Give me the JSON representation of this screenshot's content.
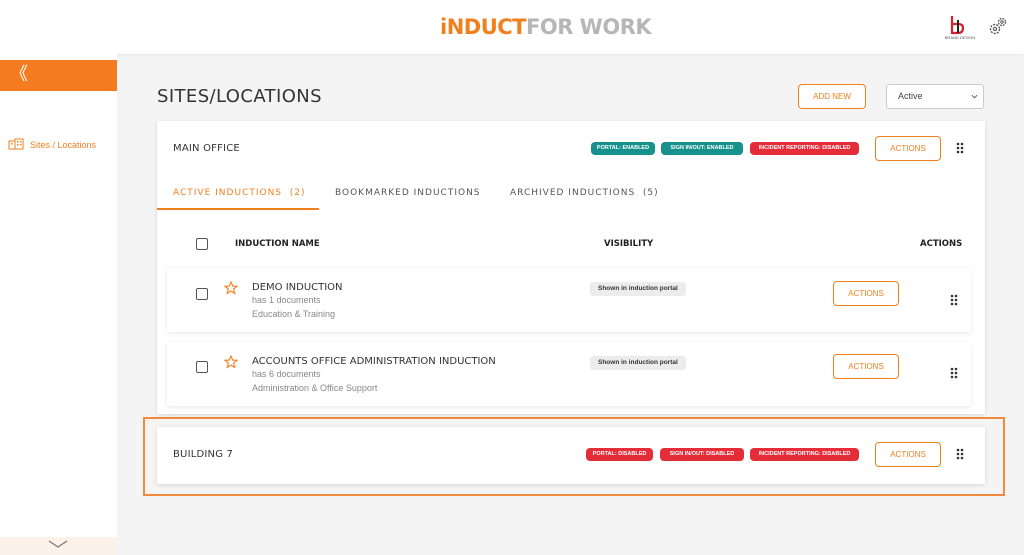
{
  "header": {
    "logo_part1": "iNDUCT",
    "logo_part2": "FOR WORK",
    "brand_text": "BRAND DESIGN"
  },
  "sidebar": {
    "collapse_glyph": "《",
    "items": [
      {
        "label": "Sites / Locations",
        "icon": "buildings-icon"
      }
    ]
  },
  "page": {
    "title": "SITES/LOCATIONS",
    "add_new_label": "ADD NEW",
    "status_filter": {
      "selected": "Active"
    }
  },
  "sites": [
    {
      "name": "MAIN OFFICE",
      "badges": [
        {
          "label": "PORTAL: ENABLED",
          "color": "#17918c"
        },
        {
          "label": "SIGN IN/OUT: ENABLED",
          "color": "#17918c"
        },
        {
          "label": "INCIDENT REPORTING: DISABLED",
          "color": "#e42d38"
        }
      ],
      "actions_label": "ACTIONS",
      "tabs": [
        {
          "label": "ACTIVE INDUCTIONS",
          "count": "(2)",
          "active": true
        },
        {
          "label": "BOOKMARKED INDUCTIONS",
          "count": "",
          "active": false
        },
        {
          "label": "ARCHIVED INDUCTIONS",
          "count": "(5)",
          "active": false
        }
      ],
      "table": {
        "columns": [
          "INDUCTION NAME",
          "VISIBILITY",
          "ACTIONS"
        ],
        "rows": [
          {
            "name": "DEMO INDUCTION",
            "documents": "has 1 documents",
            "category": "Education & Training",
            "visibility": "Shown in induction portal",
            "actions_label": "ACTIONS"
          },
          {
            "name": "ACCOUNTS OFFICE ADMINISTRATION INDUCTION",
            "documents": "has 6 documents",
            "category": "Administration & Office Support",
            "visibility": "Shown in induction portal",
            "actions_label": "ACTIONS"
          }
        ]
      }
    },
    {
      "name": "BUILDING 7",
      "badges": [
        {
          "label": "PORTAL: DISABLED",
          "color": "#e42d38"
        },
        {
          "label": "SIGN IN/OUT: DISABLED",
          "color": "#e42d38"
        },
        {
          "label": "INCIDENT REPORTING: DISABLED",
          "color": "#e42d38"
        }
      ],
      "actions_label": "ACTIONS"
    }
  ],
  "colors": {
    "accent": "#f07f1e",
    "enabled": "#17918c",
    "disabled": "#e42d38"
  }
}
